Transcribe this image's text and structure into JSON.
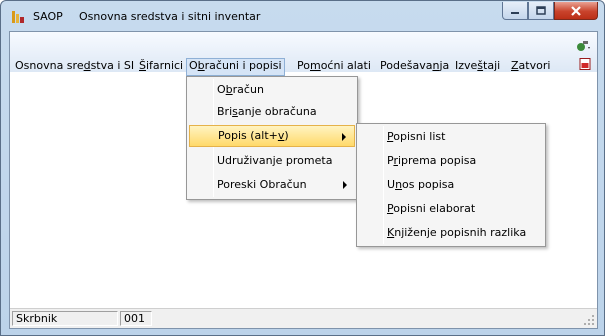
{
  "window": {
    "app_name": "SAOP",
    "title": "Osnovna sredstva i sitni inventar",
    "icons": {
      "app": "saop-app-icon",
      "tools": "tools-icon",
      "pdf": "pdf-icon"
    }
  },
  "menubar": {
    "items": [
      {
        "pre": "Osnovna sre",
        "ul": "d",
        "post": "stva i SI"
      },
      {
        "pre": "",
        "ul": "Š",
        "post": "ifarnici"
      },
      {
        "pre": "O",
        "ul": "b",
        "post": "računi i popisi"
      },
      {
        "pre": "Po",
        "ul": "m",
        "post": "oćni alati"
      },
      {
        "pre": "Podešava",
        "ul": "n",
        "post": "ja"
      },
      {
        "pre": "Izve",
        "ul": "š",
        "post": "taji"
      },
      {
        "pre": "",
        "ul": "Z",
        "post": "atvori"
      }
    ]
  },
  "dropdown": {
    "items": [
      {
        "pre": "O",
        "ul": "b",
        "post": "račun"
      },
      {
        "pre": "Bri",
        "ul": "s",
        "post": "anje obračuna"
      },
      {
        "pre": "Popis (alt+",
        "ul": "v",
        "post": ")"
      },
      {
        "pre": "Udruživanje prometa",
        "ul": "",
        "post": ""
      },
      {
        "pre": "Poreski Obračun",
        "ul": "",
        "post": ""
      }
    ]
  },
  "submenu": {
    "items": [
      {
        "pre": "",
        "ul": "P",
        "post": "opisni list"
      },
      {
        "pre": "P",
        "ul": "r",
        "post": "iprema popisa"
      },
      {
        "pre": "U",
        "ul": "n",
        "post": "os popisa"
      },
      {
        "pre": "",
        "ul": "P",
        "post": "opisni elaborat"
      },
      {
        "pre": "",
        "ul": "K",
        "post": "njiženje popisnih razlika"
      }
    ]
  },
  "statusbar": {
    "label": "Skrbnik",
    "value": "001"
  },
  "colors": {
    "highlight": "#ffd96a",
    "menubar_active": "#d5e4f6",
    "close_button": "#c9432c"
  }
}
